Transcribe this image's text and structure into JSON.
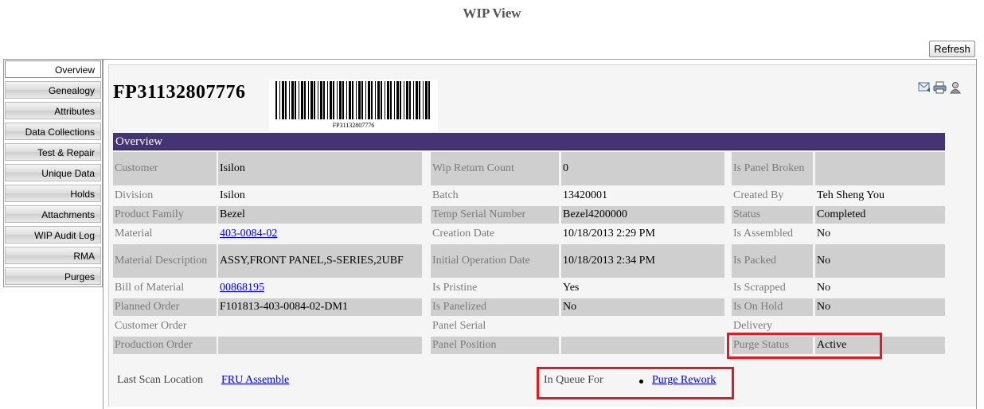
{
  "page_title": "WIP View",
  "toolbar": {
    "refresh_label": "Refresh"
  },
  "sidebar": {
    "items": [
      {
        "label": "Overview"
      },
      {
        "label": "Genealogy"
      },
      {
        "label": "Attributes"
      },
      {
        "label": "Data Collections"
      },
      {
        "label": "Test & Repair"
      },
      {
        "label": "Unique Data"
      },
      {
        "label": "Holds"
      },
      {
        "label": "Attachments"
      },
      {
        "label": "WIP Audit Log"
      },
      {
        "label": "RMA"
      },
      {
        "label": "Purges"
      }
    ]
  },
  "header": {
    "serial_number": "FP31132807776",
    "barcode_text": "FP31132807776",
    "icons": [
      "email-icon",
      "print-icon",
      "user-icon"
    ]
  },
  "overview": {
    "section_title": "Overview",
    "col1": [
      {
        "label": "Customer",
        "value": "Isilon"
      },
      {
        "label": "Division",
        "value": "Isilon"
      },
      {
        "label": "Product Family",
        "value": "Bezel"
      },
      {
        "label": "Material",
        "value": "403-0084-02"
      },
      {
        "label": "Material Description",
        "value": "ASSY,FRONT PANEL,S-SERIES,2UBF"
      },
      {
        "label": "Bill of Material",
        "value": "00868195"
      },
      {
        "label": "Planned Order",
        "value": "F101813-403-0084-02-DM1"
      },
      {
        "label": "Customer Order",
        "value": ""
      },
      {
        "label": "Production Order",
        "value": ""
      }
    ],
    "col2": [
      {
        "label": "Wip Return Count",
        "value": "0"
      },
      {
        "label": "Batch",
        "value": "13420001"
      },
      {
        "label": "Temp Serial Number",
        "value": "Bezel4200000"
      },
      {
        "label": "Creation Date",
        "value": "10/18/2013 2:29 PM"
      },
      {
        "label": "Initial Operation Date",
        "value": "10/18/2013 2:34 PM"
      },
      {
        "label": "Is Pristine",
        "value": "Yes"
      },
      {
        "label": "Is Panelized",
        "value": "No"
      },
      {
        "label": "Panel Serial",
        "value": ""
      },
      {
        "label": "Panel Position",
        "value": ""
      }
    ],
    "col3": [
      {
        "label": "Is Panel Broken",
        "value": ""
      },
      {
        "label": "Created By",
        "value": "Teh Sheng You"
      },
      {
        "label": "Status",
        "value": "Completed"
      },
      {
        "label": "Is Assembled",
        "value": "No"
      },
      {
        "label": "Is Packed",
        "value": "No"
      },
      {
        "label": "Is Scrapped",
        "value": "No"
      },
      {
        "label": "Is On Hold",
        "value": "No"
      },
      {
        "label": "Delivery",
        "value": ""
      },
      {
        "label": "Purge Status",
        "value": "Active"
      }
    ]
  },
  "footer": {
    "last_scan_label": "Last Scan Location",
    "last_scan_value": "FRU Assemble",
    "queue_label": "In Queue For",
    "queue_items": [
      "Purge Rework"
    ]
  },
  "colors": {
    "header_bg": "#443473",
    "row_shade": "#cfcfcf",
    "highlight": "#e31a23",
    "link": "#0000ee"
  }
}
